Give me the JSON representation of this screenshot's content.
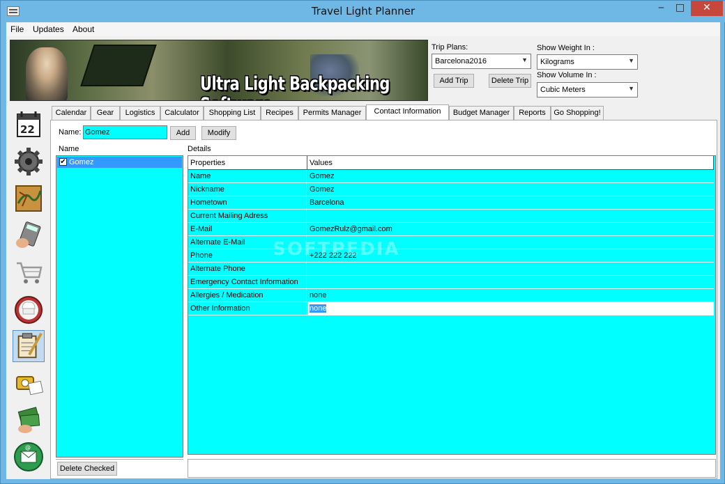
{
  "window": {
    "title": "Travel Light Planner",
    "minimize_glyph": "‒",
    "maximize_glyph": "□",
    "close_glyph": "✕"
  },
  "menu": {
    "items": [
      "File",
      "Updates",
      "About"
    ]
  },
  "banner": {
    "text": "Ultra Light Backpacking Software"
  },
  "trip_controls": {
    "trip_plans_label": "Trip Plans:",
    "trip_plans_value": "Barcelona2016",
    "add_trip_label": "Add Trip",
    "delete_trip_label": "Delete Trip",
    "show_weight_label": "Show Weight In :",
    "show_weight_value": "Kilograms",
    "show_volume_label": "Show Volume In :",
    "show_volume_value": "Cubic Meters"
  },
  "sidebar": {
    "icons": [
      "calendar-icon",
      "gear-icon",
      "map-icon",
      "calculator-icon",
      "shopping-cart-icon",
      "recipe-pot-icon",
      "clipboard-icon",
      "phone-contact-icon",
      "money-icon",
      "email-icon"
    ],
    "calendar_day": "22",
    "selected_index": 6
  },
  "tabs": [
    {
      "label": "Calendar"
    },
    {
      "label": "Gear"
    },
    {
      "label": "Logistics"
    },
    {
      "label": "Calculator"
    },
    {
      "label": "Shopping List"
    },
    {
      "label": "Recipes"
    },
    {
      "label": "Permits Manager"
    },
    {
      "label": "Contact Information",
      "active": true
    },
    {
      "label": "Budget Manager"
    },
    {
      "label": "Reports"
    },
    {
      "label": "Go Shopping!"
    }
  ],
  "contact": {
    "name_label": "Name:",
    "name_value": "Gomez",
    "add_label": "Add",
    "modify_label": "Modify",
    "list_header": "Name",
    "list_items": [
      {
        "label": "Gomez",
        "checked": true,
        "selected": true
      }
    ],
    "delete_checked_label": "Delete Checked",
    "details_header": "Details",
    "grid_headers": {
      "properties": "Properties",
      "values": "Values"
    },
    "rows": [
      {
        "property": "Name",
        "value": "Gomez"
      },
      {
        "property": "Nickname",
        "value": "Gomez"
      },
      {
        "property": "Hometown",
        "value": "Barcelona"
      },
      {
        "property": "Current Mailing Adress",
        "value": ""
      },
      {
        "property": "E-Mail",
        "value": "GomezRulz@gmail.com"
      },
      {
        "property": "Alternate E-Mail",
        "value": ""
      },
      {
        "property": "Phone",
        "value": "+222 222 222"
      },
      {
        "property": "Alternate Phone",
        "value": ""
      },
      {
        "property": "Emergency Contact Information",
        "value": ""
      },
      {
        "property": "Allergies / Medication",
        "value": "none"
      },
      {
        "property": "Other Information",
        "value": "none"
      }
    ]
  },
  "watermark": "SOFTPEDIA",
  "colors": {
    "accent_cyan": "#00ffff",
    "selection_blue": "#3399ff",
    "titlebar_blue": "#6fb8e6",
    "close_red": "#c7473b"
  }
}
